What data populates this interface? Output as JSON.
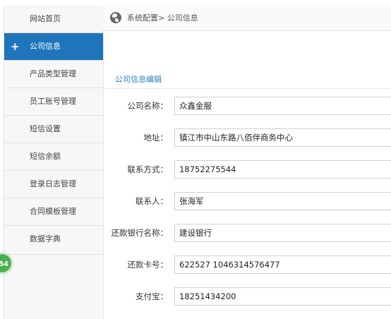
{
  "sidebar": {
    "items": [
      {
        "label": "网站首页",
        "active": false
      },
      {
        "label": "公司信息",
        "active": true
      },
      {
        "label": "产品类型管理",
        "active": false
      },
      {
        "label": "员工账号管理",
        "active": false
      },
      {
        "label": "短信设置",
        "active": false
      },
      {
        "label": "短信余额",
        "active": false
      },
      {
        "label": "登录日志管理",
        "active": false
      },
      {
        "label": "合同模板管理",
        "active": false
      },
      {
        "label": "数据字典",
        "active": false
      }
    ],
    "active_marker": "+",
    "badge": "54"
  },
  "breadcrumb": {
    "icon": "globe-icon",
    "text": "系统配置> 公司信息"
  },
  "form": {
    "title": "公司信息编辑",
    "fields": [
      {
        "label": "公司名称：",
        "value": "众鑫金服"
      },
      {
        "label": "地址：",
        "value": "镇江市中山东路八佰伴商务中心"
      },
      {
        "label": "联系方式：",
        "value": "18752275544"
      },
      {
        "label": "联系人：",
        "value": "张海军"
      },
      {
        "label": "还款银行名称：",
        "value": "建设银行"
      },
      {
        "label": "还款卡号：",
        "value": "622527  1046314576477"
      },
      {
        "label": "支付宝：",
        "value": "18251434200"
      }
    ]
  },
  "colors": {
    "accent": "#1f75bb",
    "title": "#2a7fc6",
    "badge": "#4caf50"
  }
}
